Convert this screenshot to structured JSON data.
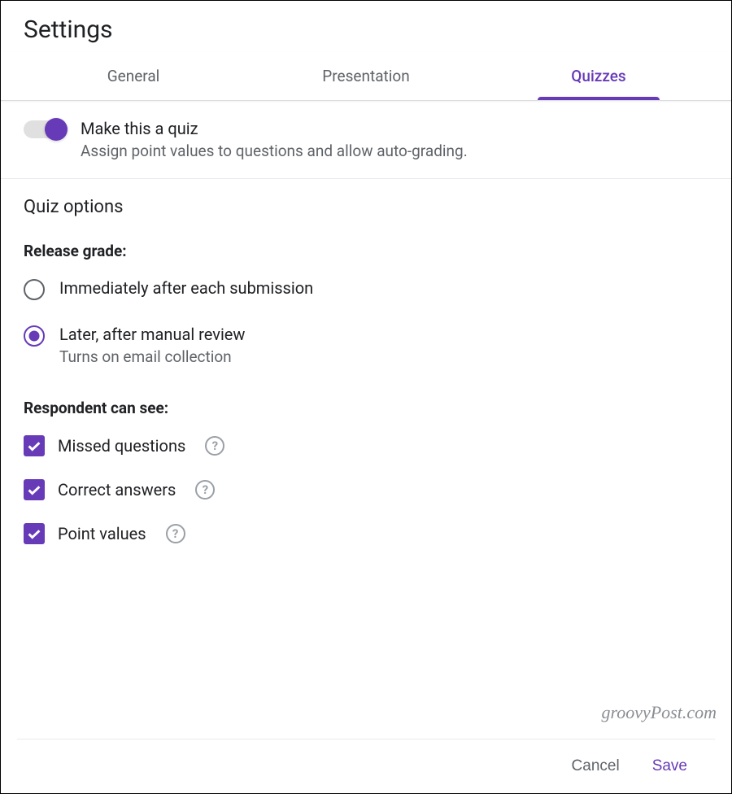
{
  "colors": {
    "accent": "#673ab7",
    "text_secondary": "#5f6368"
  },
  "header": {
    "title": "Settings"
  },
  "tabs": [
    {
      "label": "General",
      "active": false
    },
    {
      "label": "Presentation",
      "active": false
    },
    {
      "label": "Quizzes",
      "active": true
    }
  ],
  "quiz_toggle": {
    "on": true,
    "title": "Make this a quiz",
    "subtitle": "Assign point values to questions and allow auto-grading."
  },
  "quiz_options": {
    "section_title": "Quiz options",
    "release_grade": {
      "label": "Release grade:",
      "options": [
        {
          "label": "Immediately after each submission",
          "sub": "",
          "checked": false
        },
        {
          "label": "Later, after manual review",
          "sub": "Turns on email collection",
          "checked": true
        }
      ]
    },
    "respondent": {
      "label": "Respondent can see:",
      "options": [
        {
          "label": "Missed questions",
          "checked": true
        },
        {
          "label": "Correct answers",
          "checked": true
        },
        {
          "label": "Point values",
          "checked": true
        }
      ]
    }
  },
  "footer": {
    "cancel": "Cancel",
    "save": "Save"
  },
  "watermark": "groovyPost.com"
}
